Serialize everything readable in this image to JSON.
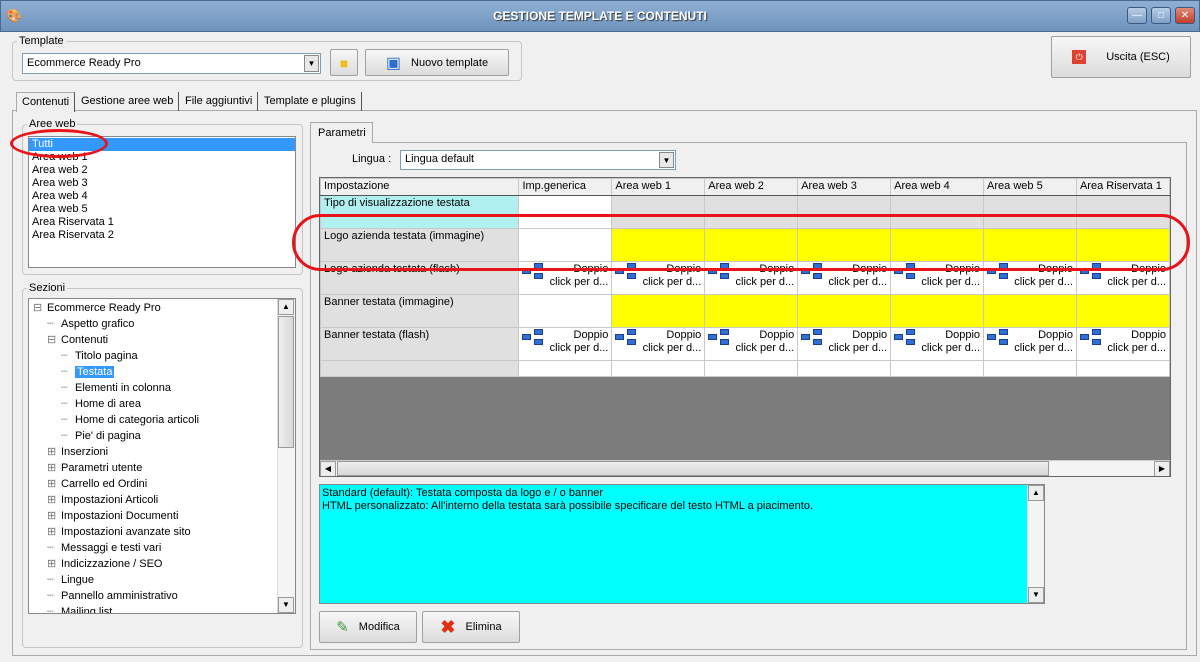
{
  "window": {
    "title": "GESTIONE TEMPLATE E CONTENUTI"
  },
  "template": {
    "group_label": "Template",
    "selected": "Ecommerce Ready Pro",
    "new_button": "Nuovo template"
  },
  "exit_button": "Uscita (ESC)",
  "tabs": [
    "Contenuti",
    "Gestione aree web",
    "File aggiuntivi",
    "Template e plugins"
  ],
  "aree_web": {
    "label": "Aree web",
    "items": [
      "Tutti",
      "Area web 1",
      "Area web 2",
      "Area web 3",
      "Area web 4",
      "Area web 5",
      "Area Riservata 1",
      "Area Riservata 2"
    ],
    "selected": 0
  },
  "sezioni": {
    "label": "Sezioni",
    "items": [
      {
        "label": "Ecommerce Ready Pro",
        "level": 0,
        "exp": "⊟"
      },
      {
        "label": "Aspetto grafico",
        "level": 1
      },
      {
        "label": "Contenuti",
        "level": 1,
        "exp": "⊟"
      },
      {
        "label": "Titolo pagina",
        "level": 2
      },
      {
        "label": "Testata",
        "level": 2,
        "selected": true
      },
      {
        "label": "Elementi in colonna",
        "level": 2
      },
      {
        "label": "Home di area",
        "level": 2
      },
      {
        "label": "Home di categoria articoli",
        "level": 2
      },
      {
        "label": "Pie' di pagina",
        "level": 2
      },
      {
        "label": "Inserzioni",
        "level": 1,
        "exp": "⊞"
      },
      {
        "label": "Parametri utente",
        "level": 1,
        "exp": "⊞"
      },
      {
        "label": "Carrello ed Ordini",
        "level": 1,
        "exp": "⊞"
      },
      {
        "label": "Impostazioni Articoli",
        "level": 1,
        "exp": "⊞"
      },
      {
        "label": "Impostazioni Documenti",
        "level": 1,
        "exp": "⊞"
      },
      {
        "label": "Impostazioni avanzate sito",
        "level": 1,
        "exp": "⊞"
      },
      {
        "label": "Messaggi e testi vari",
        "level": 1
      },
      {
        "label": "Indicizzazione / SEO",
        "level": 1,
        "exp": "⊞"
      },
      {
        "label": "Lingue",
        "level": 1
      },
      {
        "label": "Pannello amministrativo",
        "level": 1
      },
      {
        "label": "Mailing list",
        "level": 1
      }
    ]
  },
  "parametri": {
    "tab": "Parametri",
    "lingua_label": "Lingua :",
    "lingua_value": "Lingua default",
    "columns": [
      "Impostazione",
      "Imp.generica",
      "Area web 1",
      "Area web 2",
      "Area web 3",
      "Area web 4",
      "Area web 5",
      "Area Riservata 1"
    ],
    "dbl_text": [
      "Doppio",
      "click per d..."
    ],
    "rows": [
      {
        "label": "Tipo di visualizzazione testata",
        "type": "first"
      },
      {
        "label": "Logo azienda testata (immagine)",
        "type": "yellow"
      },
      {
        "label": "Logo azienda testata (flash)",
        "type": "dbl"
      },
      {
        "label": "Banner testata (immagine)",
        "type": "yellow"
      },
      {
        "label": "Banner testata (flash)",
        "type": "dbl"
      },
      {
        "label": "",
        "type": "empty"
      }
    ]
  },
  "description": [
    "Standard (default): Testata composta da logo e / o banner",
    "HTML personalizzato: All'interno della testata sarà possibile specificare del testo HTML a piacimento."
  ],
  "buttons": {
    "modifica": "Modifica",
    "elimina": "Elimina"
  }
}
